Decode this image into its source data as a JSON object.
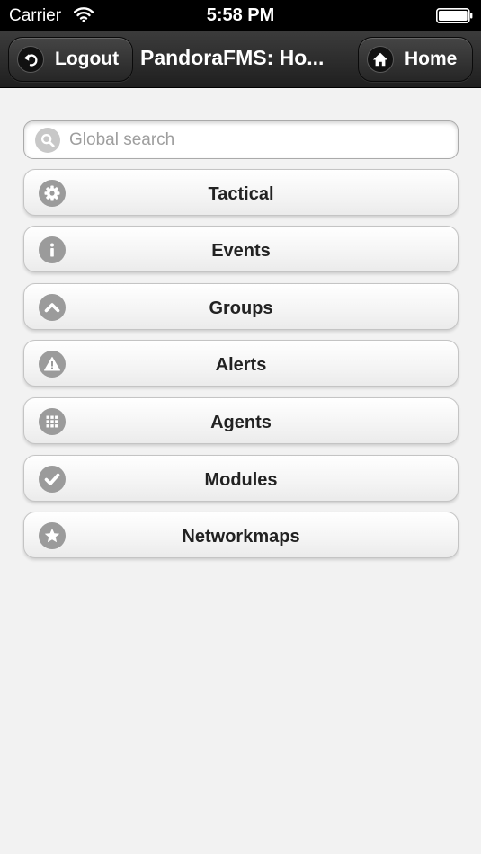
{
  "status_bar": {
    "carrier": "Carrier",
    "time": "5:58 PM",
    "icons": [
      "wifi-icon",
      "battery-icon"
    ]
  },
  "header": {
    "title": "PandoraFMS: Ho...",
    "logout_label": "Logout",
    "logout_icon": "back-arrow-icon",
    "home_label": "Home",
    "home_icon": "home-icon",
    "bar_color": "#2a2a2a"
  },
  "search": {
    "placeholder": "Global search",
    "value": "",
    "icon": "search-icon"
  },
  "menu": {
    "items": [
      {
        "label": "Tactical",
        "icon": "gear-icon"
      },
      {
        "label": "Events",
        "icon": "info-icon"
      },
      {
        "label": "Groups",
        "icon": "chevron-up-icon"
      },
      {
        "label": "Alerts",
        "icon": "warning-icon"
      },
      {
        "label": "Agents",
        "icon": "grid-icon"
      },
      {
        "label": "Modules",
        "icon": "check-icon"
      },
      {
        "label": "Networkmaps",
        "icon": "star-icon"
      }
    ]
  },
  "colors": {
    "background": "#f2f2f2",
    "icon_circle": "#9b9b9b",
    "label_text": "#222222"
  }
}
